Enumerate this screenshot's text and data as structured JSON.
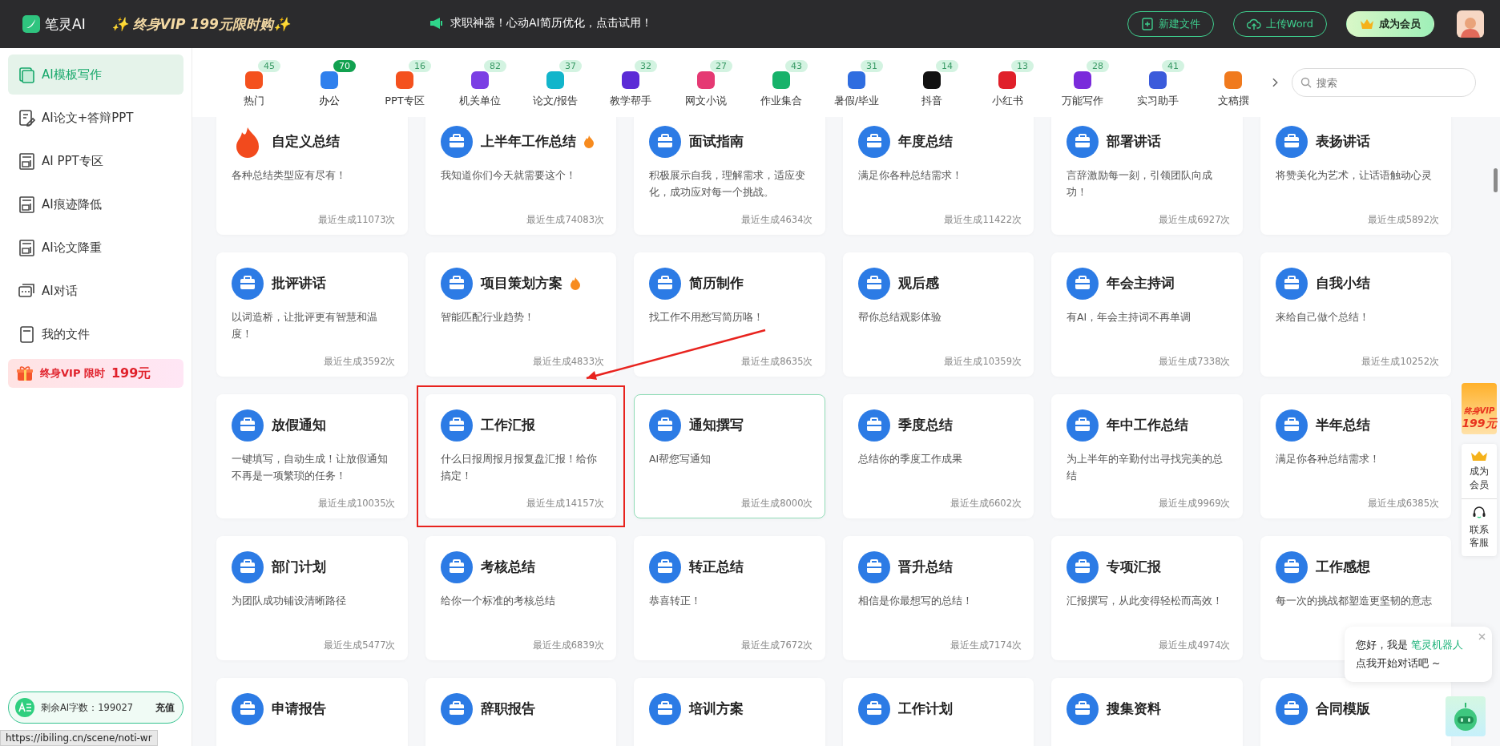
{
  "topbar": {
    "logo": "笔灵AI",
    "promo": "✨ 终身VIP 199元限时购✨",
    "announcement": "求职神器！心动AI简历优化，点击试用！",
    "buttons": [
      {
        "label": "新建文件",
        "kind": "new"
      },
      {
        "label": "上传Word",
        "kind": "upload"
      },
      {
        "label": "成为会员",
        "kind": "member"
      }
    ]
  },
  "sidebar": {
    "items": [
      {
        "label": "AI模板写作",
        "kind": "template",
        "selected": true
      },
      {
        "label": "AI论文+答辩PPT",
        "kind": "pen",
        "selected": false
      },
      {
        "label": "AI PPT专区",
        "kind": "doc",
        "selected": false
      },
      {
        "label": "AI痕迹降低",
        "kind": "doc",
        "selected": false
      },
      {
        "label": "AI论文降重",
        "kind": "doc",
        "selected": false
      },
      {
        "label": "AI对话",
        "kind": "chat",
        "selected": false
      },
      {
        "label": "我的文件",
        "kind": "file",
        "selected": false
      }
    ],
    "promo": {
      "text": "终身VIP 限时",
      "price": "199元"
    },
    "quota": {
      "label": "剩余AI字数：199027",
      "action": "充值"
    }
  },
  "categories": {
    "items": [
      {
        "label": "热门",
        "count": "45",
        "color": "#f4511e",
        "selected": false
      },
      {
        "label": "办公",
        "count": "70",
        "color": "#2f80ed",
        "selected": true
      },
      {
        "label": "PPT专区",
        "count": "16",
        "color": "#f4511e",
        "selected": false
      },
      {
        "label": "机关单位",
        "count": "82",
        "color": "#7b3fe4",
        "selected": false
      },
      {
        "label": "论文/报告",
        "count": "37",
        "color": "#12b5cb",
        "selected": false
      },
      {
        "label": "教学帮手",
        "count": "32",
        "color": "#5b2bd6",
        "selected": false
      },
      {
        "label": "网文小说",
        "count": "27",
        "color": "#e53973",
        "selected": false
      },
      {
        "label": "作业集合",
        "count": "43",
        "color": "#17b26a",
        "selected": false
      },
      {
        "label": "暑假/毕业",
        "count": "31",
        "color": "#2f6de0",
        "selected": false
      },
      {
        "label": "抖音",
        "count": "14",
        "color": "#111111",
        "selected": false
      },
      {
        "label": "小红书",
        "count": "13",
        "color": "#e0202a",
        "selected": false
      },
      {
        "label": "万能写作",
        "count": "28",
        "color": "#7a2bdb",
        "selected": false
      },
      {
        "label": "实习助手",
        "count": "41",
        "color": "#3b5bdb",
        "selected": false
      },
      {
        "label": "文稿撰",
        "color": "#f07a1e",
        "selected": false
      }
    ],
    "search_placeholder": "搜索"
  },
  "cards": [
    {
      "title": "自定义总结",
      "description": "各种总结类型应有尽有！",
      "count": "最近生成11073次",
      "kind": "hot",
      "fire": false,
      "highlighted": false,
      "annotated": false
    },
    {
      "title": "上半年工作总结",
      "description": "我知道你们今天就需要这个！",
      "count": "最近生成74083次",
      "kind": "briefcase",
      "fire": true,
      "highlighted": false,
      "annotated": false
    },
    {
      "title": "面试指南",
      "description": "积极展示自我，理解需求，适应变化，成功应对每一个挑战。",
      "count": "最近生成4634次",
      "kind": "briefcase",
      "fire": false,
      "highlighted": false,
      "annotated": false
    },
    {
      "title": "年度总结",
      "description": "满足你各种总结需求！",
      "count": "最近生成11422次",
      "kind": "briefcase",
      "fire": false,
      "highlighted": false,
      "annotated": false
    },
    {
      "title": "部署讲话",
      "description": "言辞激励每一刻，引领团队向成功！",
      "count": "最近生成6927次",
      "kind": "briefcase",
      "fire": false,
      "highlighted": false,
      "annotated": false
    },
    {
      "title": "表扬讲话",
      "description": "将赞美化为艺术，让话语触动心灵",
      "count": "最近生成5892次",
      "kind": "briefcase",
      "fire": false,
      "highlighted": false,
      "annotated": false
    },
    {
      "title": "批评讲话",
      "description": "以词造桥，让批评更有智慧和温度！",
      "count": "最近生成3592次",
      "kind": "briefcase",
      "fire": false,
      "highlighted": false,
      "annotated": false
    },
    {
      "title": "项目策划方案",
      "description": "智能匹配行业趋势！",
      "count": "最近生成4833次",
      "kind": "briefcase",
      "fire": true,
      "highlighted": false,
      "annotated": false
    },
    {
      "title": "简历制作",
      "description": "找工作不用愁写简历咯！",
      "count": "最近生成8635次",
      "kind": "briefcase",
      "fire": false,
      "highlighted": false,
      "annotated": false
    },
    {
      "title": "观后感",
      "description": "帮你总结观影体验",
      "count": "最近生成10359次",
      "kind": "briefcase",
      "fire": false,
      "highlighted": false,
      "annotated": false
    },
    {
      "title": "年会主持词",
      "description": "有AI，年会主持词不再单调",
      "count": "最近生成7338次",
      "kind": "briefcase",
      "fire": false,
      "highlighted": false,
      "annotated": false
    },
    {
      "title": "自我小结",
      "description": "来给自己做个总结！",
      "count": "最近生成10252次",
      "kind": "briefcase",
      "fire": false,
      "highlighted": false,
      "annotated": false
    },
    {
      "title": "放假通知",
      "description": "一键填写，自动生成！让放假通知不再是一项繁琐的任务！",
      "count": "最近生成10035次",
      "kind": "briefcase",
      "fire": false,
      "highlighted": false,
      "annotated": false
    },
    {
      "title": "工作汇报",
      "description": "什么日报周报月报复盘汇报！给你搞定！",
      "count": "最近生成14157次",
      "kind": "briefcase",
      "fire": false,
      "highlighted": false,
      "annotated": true
    },
    {
      "title": "通知撰写",
      "description": "AI帮您写通知",
      "count": "最近生成8000次",
      "kind": "briefcase",
      "fire": false,
      "highlighted": true,
      "annotated": false
    },
    {
      "title": "季度总结",
      "description": "总结你的季度工作成果",
      "count": "最近生成6602次",
      "kind": "briefcase",
      "fire": false,
      "highlighted": false,
      "annotated": false
    },
    {
      "title": "年中工作总结",
      "description": "为上半年的辛勤付出寻找完美的总结",
      "count": "最近生成9969次",
      "kind": "briefcase",
      "fire": false,
      "highlighted": false,
      "annotated": false
    },
    {
      "title": "半年总结",
      "description": "满足你各种总结需求！",
      "count": "最近生成6385次",
      "kind": "briefcase",
      "fire": false,
      "highlighted": false,
      "annotated": false
    },
    {
      "title": "部门计划",
      "description": "为团队成功铺设清晰路径",
      "count": "最近生成5477次",
      "kind": "briefcase",
      "fire": false,
      "highlighted": false,
      "annotated": false
    },
    {
      "title": "考核总结",
      "description": "给你一个标准的考核总结",
      "count": "最近生成6839次",
      "kind": "briefcase",
      "fire": false,
      "highlighted": false,
      "annotated": false
    },
    {
      "title": "转正总结",
      "description": "恭喜转正！",
      "count": "最近生成7672次",
      "kind": "briefcase",
      "fire": false,
      "highlighted": false,
      "annotated": false
    },
    {
      "title": "晋升总结",
      "description": "相信是你最想写的总结！",
      "count": "最近生成7174次",
      "kind": "briefcase",
      "fire": false,
      "highlighted": false,
      "annotated": false
    },
    {
      "title": "专项汇报",
      "description": "汇报撰写，从此变得轻松而高效！",
      "count": "最近生成4974次",
      "kind": "briefcase",
      "fire": false,
      "highlighted": false,
      "annotated": false
    },
    {
      "title": "工作感想",
      "description": "每一次的挑战都塑造更坚韧的意志",
      "kind": "briefcase",
      "fire": false,
      "highlighted": false,
      "annotated": false
    },
    {
      "title": "申请报告",
      "kind": "briefcase",
      "fire": false,
      "highlighted": false,
      "annotated": false
    },
    {
      "title": "辞职报告",
      "kind": "briefcase",
      "fire": false,
      "highlighted": false,
      "annotated": false
    },
    {
      "title": "培训方案",
      "kind": "briefcase",
      "fire": false,
      "highlighted": false,
      "annotated": false
    },
    {
      "title": "工作计划",
      "kind": "briefcase",
      "fire": false,
      "highlighted": false,
      "annotated": false
    },
    {
      "title": "搜集资料",
      "kind": "briefcase",
      "fire": false,
      "highlighted": false,
      "annotated": false
    },
    {
      "title": "合同模版",
      "kind": "briefcase",
      "fire": false,
      "highlighted": false,
      "annotated": false
    }
  ],
  "float_panel": {
    "vip": {
      "line1": "终身VIP",
      "line2": "199元"
    },
    "items": [
      {
        "label": "成为会员",
        "kind": "member"
      },
      {
        "label": "联系客服",
        "kind": "service"
      }
    ]
  },
  "chat": {
    "greeting": "您好，我是",
    "bot_name": "笔灵机器人",
    "prompt": "点我开始对话吧 ~"
  },
  "status_url": "https://ibiling.cn/scene/noti-wr"
}
